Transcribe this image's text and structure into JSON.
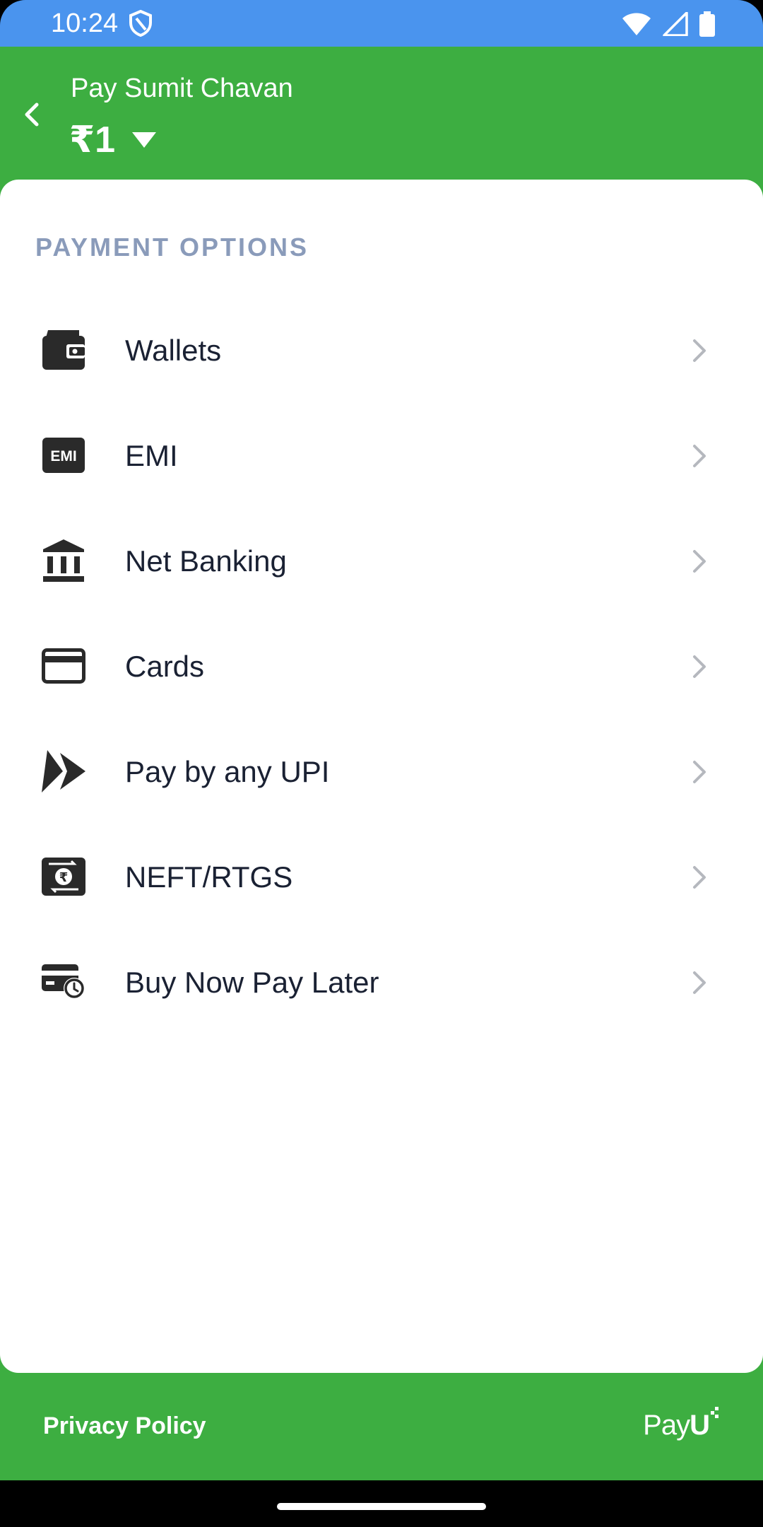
{
  "status_bar": {
    "time": "10:24",
    "icons": [
      "shield-icon",
      "wifi-icon",
      "signal-icon",
      "battery-icon"
    ]
  },
  "header": {
    "payee": "Pay Sumit Chavan",
    "amount": "₹1",
    "background_color": "#3DAE41"
  },
  "section": {
    "title": "PAYMENT OPTIONS"
  },
  "options": [
    {
      "label": "Wallets",
      "icon": "wallet-icon"
    },
    {
      "label": "EMI",
      "icon": "emi-icon",
      "icon_text": "EMI"
    },
    {
      "label": "Net Banking",
      "icon": "bank-icon"
    },
    {
      "label": "Cards",
      "icon": "card-icon"
    },
    {
      "label": "Pay by any UPI",
      "icon": "upi-icon"
    },
    {
      "label": "NEFT/RTGS",
      "icon": "neft-icon",
      "icon_text": "₹"
    },
    {
      "label": "Buy Now Pay Later",
      "icon": "bnpl-icon"
    }
  ],
  "footer": {
    "privacy_label": "Privacy Policy",
    "brand_prefix": "Pay",
    "brand_suffix": "U"
  },
  "colors": {
    "status_bar": "#4A94EE",
    "brand_green": "#3DAE41",
    "section_title": "#8A9BBA",
    "text_primary": "#1A2133",
    "chevron": "#B5B8BE"
  }
}
